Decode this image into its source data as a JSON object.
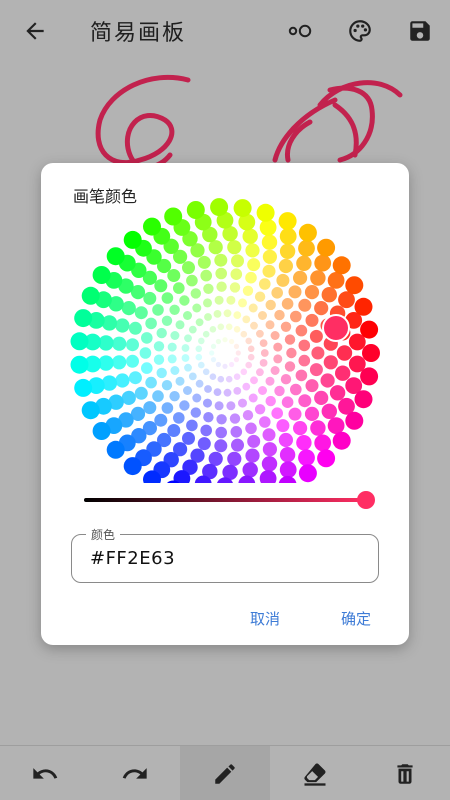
{
  "appbar": {
    "title": "简易画板",
    "icons": [
      "arrow-back-icon",
      "stroke-width-icon",
      "palette-icon",
      "save-icon"
    ]
  },
  "dialog": {
    "title": "画笔颜色",
    "field_label": "颜色",
    "field_value": "#FF2E63",
    "cancel": "取消",
    "confirm": "确定",
    "selected_color": "#FF2E63"
  },
  "toolbar": {
    "tools": [
      "undo-icon",
      "redo-icon",
      "pen-icon",
      "eraser-icon",
      "delete-icon"
    ],
    "active": "pen-icon"
  },
  "colors": {
    "stroke": "#c2224e",
    "accent": "#3d7bd6",
    "background": "#b3b3b3"
  }
}
